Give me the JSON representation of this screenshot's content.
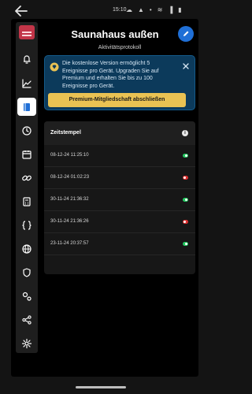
{
  "status_bar": {
    "time": "15:10",
    "icons": [
      "cloud-icon",
      "bell-icon",
      "dot-icon",
      "wifi-icon",
      "signal-icon",
      "battery-icon"
    ]
  },
  "sidebar": {
    "logo": "app-logo",
    "items": [
      {
        "name": "bell-icon",
        "active": false
      },
      {
        "name": "chart-icon",
        "active": false
      },
      {
        "name": "book-icon",
        "active": true
      },
      {
        "name": "clock-icon",
        "active": false
      },
      {
        "name": "calendar-icon",
        "active": false
      },
      {
        "name": "link-icon",
        "active": false
      },
      {
        "name": "calculator-icon",
        "active": false
      },
      {
        "name": "code-icon",
        "active": false
      },
      {
        "name": "globe-icon",
        "active": false
      },
      {
        "name": "shield-icon",
        "active": false
      },
      {
        "name": "gears-icon",
        "active": false
      },
      {
        "name": "share-icon",
        "active": false
      },
      {
        "name": "settings-icon",
        "active": false
      }
    ]
  },
  "header": {
    "title": "Saunahaus außen",
    "subtitle": "Aktivitätsprotokoll"
  },
  "promo": {
    "text": "Die kostenlose Version ermöglicht 5 Ereignisse pro Gerät. Upgraden Sie auf Premium und erhalten Sie bis zu 100 Ereignisse pro Gerät.",
    "button_label": "Premium-Mitgliedschaft abschließen"
  },
  "table": {
    "header": "Zeitstempel",
    "rows": [
      {
        "timestamp": "08-12-24 11:25:10",
        "state": "on"
      },
      {
        "timestamp": "08-12-24 01:02:23",
        "state": "off"
      },
      {
        "timestamp": "30-11-24 21:36:32",
        "state": "on"
      },
      {
        "timestamp": "30-11-24 21:36:26",
        "state": "off"
      },
      {
        "timestamp": "23-11-24 20:37:57",
        "state": "on"
      }
    ]
  },
  "colors": {
    "accent": "#1f6fd6",
    "promo_bg": "#0c3a5b",
    "premium_button": "#e9c253",
    "toggle_on": "#22c55e",
    "toggle_off": "#dc2f2f",
    "logo": "#c23548"
  }
}
